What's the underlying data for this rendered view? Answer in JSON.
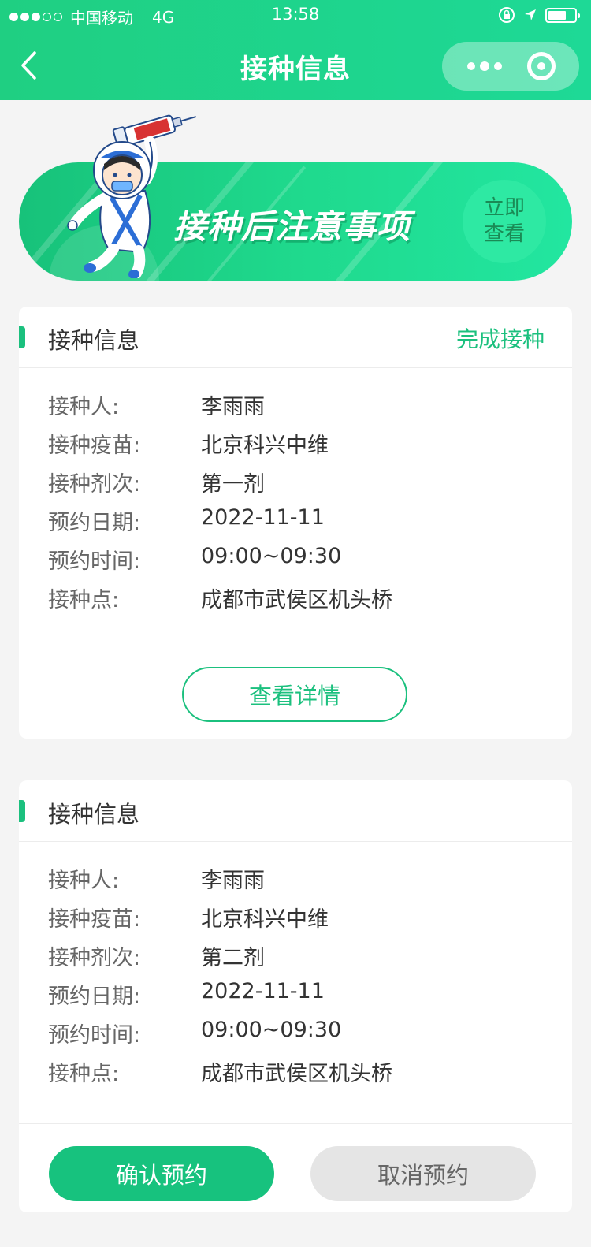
{
  "status_bar": {
    "carrier": "中国移动",
    "network": "4G",
    "time": "13:58"
  },
  "nav": {
    "title": "接种信息"
  },
  "banner": {
    "text": "接种后注意事项",
    "button_label": "立即查看"
  },
  "labels": {
    "person": "接种人:",
    "vaccine": "接种疫苗:",
    "dose": "接种剂次:",
    "date": "预约日期:",
    "time": "预约时间:",
    "site": "接种点:"
  },
  "cards": [
    {
      "title": "接种信息",
      "status": "完成接种",
      "person": "李雨雨",
      "vaccine": "北京科兴中维",
      "dose": "第一剂",
      "date": "2022-11-11",
      "time": "09:00~09:30",
      "site": "成都市武侯区机头桥",
      "detail_button": "查看详情"
    },
    {
      "title": "接种信息",
      "person": "李雨雨",
      "vaccine": "北京科兴中维",
      "dose": "第二剂",
      "date": "2022-11-11",
      "time": "09:00~09:30",
      "site": "成都市武侯区机头桥",
      "confirm_button": "确认预约",
      "cancel_button": "取消预约"
    }
  ],
  "colors": {
    "primary": "#1bc07e",
    "header_start": "#1fcf82",
    "header_end": "#1ed996",
    "background": "#f4f4f4"
  }
}
